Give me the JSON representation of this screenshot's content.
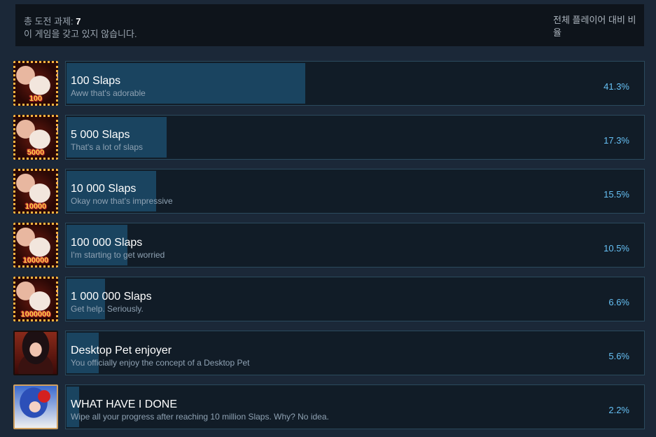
{
  "summary": {
    "total_label": "총 도전 과제:",
    "total_value": "7",
    "not_owned": "이 게임을 갖고 있지 않습니다.",
    "global_header": "전체 플레이어 대비 비율"
  },
  "achievements": [
    {
      "title": "100 Slaps",
      "description": "Aww that's adorable",
      "percent_text": "41.3%",
      "percent": 41.3,
      "icon": "slap-100-icon",
      "icon_text": "100"
    },
    {
      "title": "5 000 Slaps",
      "description": "That's a lot of slaps",
      "percent_text": "17.3%",
      "percent": 17.3,
      "icon": "slap-5000-icon",
      "icon_text": "5000"
    },
    {
      "title": "10 000 Slaps",
      "description": "Okay now that's impressive",
      "percent_text": "15.5%",
      "percent": 15.5,
      "icon": "slap-10000-icon",
      "icon_text": "10000"
    },
    {
      "title": "100 000 Slaps",
      "description": "I'm starting to get worried",
      "percent_text": "10.5%",
      "percent": 10.5,
      "icon": "slap-100000-icon",
      "icon_text": "100000"
    },
    {
      "title": "1 000 000 Slaps",
      "description": "Get help. Seriously.",
      "percent_text": "6.6%",
      "percent": 6.6,
      "icon": "slap-1000000-icon",
      "icon_text": "1000000"
    },
    {
      "title": "Desktop Pet enjoyer",
      "description": "You officially enjoy the concept of a Desktop Pet",
      "percent_text": "5.6%",
      "percent": 5.6,
      "icon": "desktop-pet-girl-icon"
    },
    {
      "title": "WHAT HAVE I DONE",
      "description": "Wipe all your progress after reaching 10 million Slaps. Why? No idea.",
      "percent_text": "2.2%",
      "percent": 2.2,
      "icon": "what-have-i-done-girl-icon"
    }
  ],
  "colors": {
    "background": "#1b2838",
    "bar_fill": "#1a4460",
    "percent_text": "#66c0f4",
    "row_border": "#2b4a5d"
  }
}
